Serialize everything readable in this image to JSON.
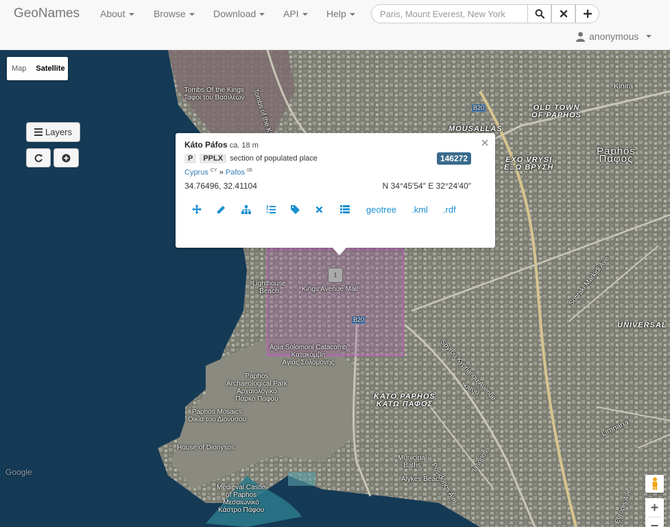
{
  "navbar": {
    "brand": "GeoNames",
    "menus": [
      {
        "label": "About"
      },
      {
        "label": "Browse"
      },
      {
        "label": "Download"
      },
      {
        "label": "API"
      },
      {
        "label": "Help"
      }
    ],
    "search": {
      "placeholder": "Paris, Mount Everest, New York",
      "value": ""
    },
    "user": "anonymous"
  },
  "map": {
    "map_types": {
      "map": "Map",
      "satellite": "Satellite",
      "active": "Satellite"
    },
    "layers_button": "Layers",
    "cluster_count": "1",
    "labels": [
      {
        "id": "tombs",
        "text": "Tombs Of the Kings\nΤαφοι του Βασιλέων"
      },
      {
        "id": "kings-ave",
        "text": "Tombs of the Kings Ave"
      },
      {
        "id": "mousallas",
        "text": "MOUSALLAS"
      },
      {
        "id": "old-town",
        "text": "OLD TOWN\nOF PAPHOS"
      },
      {
        "id": "kinira",
        "text": "Kinira"
      },
      {
        "id": "paphos",
        "text": "Paphos\nΠάφος"
      },
      {
        "id": "exo-vrysi",
        "text": "EXO VRYSI\nΕΞΩ ΒΡΥΣΗ"
      },
      {
        "id": "lighthouse",
        "text": "Lighthouse\nBeach"
      },
      {
        "id": "kings-mall",
        "text": "Kings Avenue Mall"
      },
      {
        "id": "agia",
        "text": "Agia Solomoni Catacomb\nΚατακόμβη\nΑγίας Σολομονής"
      },
      {
        "id": "arch-park",
        "text": "Paphos\nArchaeological Park\nΑρχαιολογικό\nΠάρκο Πάφου"
      },
      {
        "id": "mosaics",
        "text": "Paphos Mosaics\nΟικία του Διονύσου"
      },
      {
        "id": "house-dionysos",
        "text": "House of Dionysos"
      },
      {
        "id": "kato-paphos",
        "text": "KATO PAPHOS\nΚΑΤΩ ΠΑΦΟΣ"
      },
      {
        "id": "castle",
        "text": "Medieval Castle\nof Paphos\nΜεσαιωνικό\nΚάστρο Πάφου"
      },
      {
        "id": "municipal",
        "text": "Municipal\nBaths"
      },
      {
        "id": "alykes",
        "text": "Alykes Beach"
      },
      {
        "id": "universal",
        "text": "UNIVERSAL"
      },
      {
        "id": "limnaria",
        "text": "Limnaria"
      },
      {
        "id": "sotiraki",
        "text": "Sotiraki Markidi Ave"
      },
      {
        "id": "spyrou",
        "text": "Spyrou Kyprianou Avenue"
      },
      {
        "id": "ikarou",
        "text": "Ikarou"
      },
      {
        "id": "posidonos",
        "text": "Posidonos Ave"
      },
      {
        "id": "iasonos",
        "text": "Iasonos"
      },
      {
        "id": "evropis",
        "text": "Evropis Ave"
      },
      {
        "id": "b20a",
        "text": "B20"
      },
      {
        "id": "b20b",
        "text": "B20"
      },
      {
        "id": "google",
        "text": "Google"
      }
    ]
  },
  "popup": {
    "name": "Káto Páfos",
    "elevation": "ca. 18 m",
    "feature_class": "P",
    "feature_code": "PPLX",
    "feature_desc": "section of populated place",
    "geoname_id": "146272",
    "country": "Cyprus",
    "country_code": "CY",
    "admin1": "Pafos",
    "admin1_code": "06",
    "coords_decimal": "34.76496, 32.41104",
    "coords_dms": "N 34°45′54″ E 32°24′40″",
    "links": [
      "geotree",
      ".kml",
      ".rdf"
    ]
  },
  "colors": {
    "accent": "#1a8fd0",
    "badge": "#3a6b8c",
    "selection": "#c060c0"
  }
}
